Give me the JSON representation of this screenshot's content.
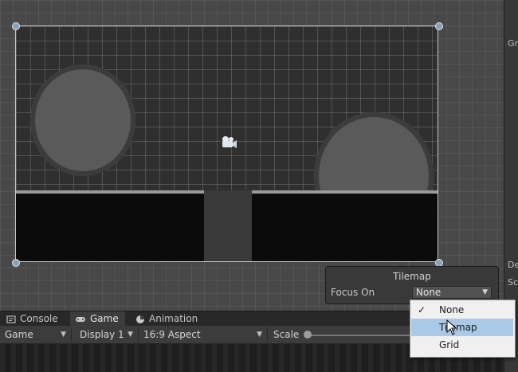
{
  "overlay": {
    "title": "Tilemap",
    "focus_label": "Focus On",
    "focus_value": "None"
  },
  "focus_menu": {
    "items": [
      {
        "label": "None",
        "checked": true
      },
      {
        "label": "Tilemap",
        "hovered": true
      },
      {
        "label": "Grid"
      }
    ]
  },
  "tabs": [
    {
      "label": "Console",
      "icon": "console-icon"
    },
    {
      "label": "Game",
      "icon": "gamepad-icon",
      "active": true
    },
    {
      "label": "Animation",
      "icon": "animation-icon"
    }
  ],
  "toolbar": {
    "view_select": "Game",
    "display_select": "Display 1",
    "aspect_select": "16:9 Aspect",
    "scale_label": "Scale"
  },
  "right_panel": {
    "labels": [
      "Gr",
      "De",
      "Sc"
    ]
  },
  "colors": {
    "menu_highlight": "#a9c9e6",
    "frame_border": "#c9c9c9",
    "panel_bg": "#3c3c3c"
  }
}
